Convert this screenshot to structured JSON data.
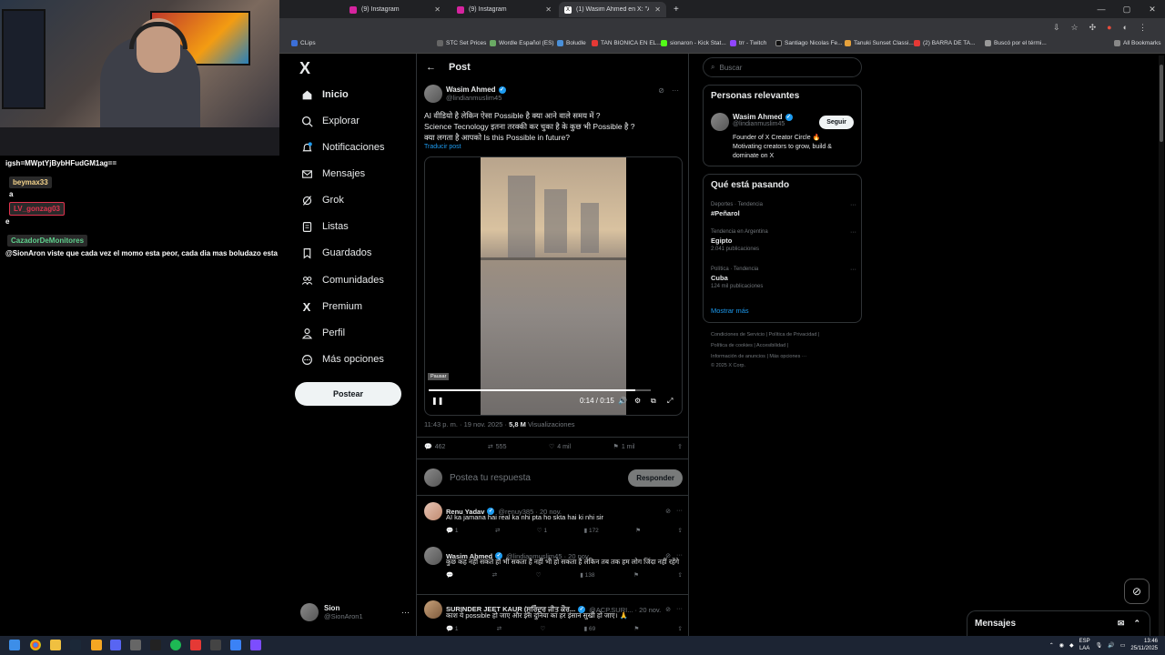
{
  "browser": {
    "tabs": [
      {
        "label": "(9) Instagram",
        "color": "#d6249f"
      },
      {
        "label": "(9) Instagram",
        "color": "#d6249f"
      },
      {
        "label": "(1) Wasim Ahmed en X: \"AI",
        "color": "#000000"
      }
    ],
    "bookmarks": [
      "CLips",
      "STC Set Prices",
      "Wordle Español (ES)",
      "Boludle",
      "TAN BIONICA EN EL...",
      "sionaron - Kick Stat...",
      "trr - Twitch",
      "Santiago Nicolas Fe...",
      "Tanuki Sunset Classi...",
      "(2) BARRA DE TA...",
      "Buscó por el térmi...",
      "All Bookmarks"
    ]
  },
  "chat": {
    "line1": "igsh=MWptYjBybHFudGM1ag==",
    "user1": "beymax33",
    "user1_msg": "a",
    "user2": "LV_gonzag03",
    "user2_msg": "e",
    "user3": "CazadorDeMonitores",
    "user3_msg": "@SionAron viste que cada vez el momo esta peor, cada dia mas boludazo esta"
  },
  "nav": {
    "logo": "X",
    "items": [
      "Inicio",
      "Explorar",
      "Notificaciones",
      "Mensajes",
      "Grok",
      "Listas",
      "Guardados",
      "Comunidades",
      "Premium",
      "Perfil",
      "Más opciones"
    ],
    "post_label": "Postear",
    "profile_name": "Sion",
    "profile_handle": "@SionAron1"
  },
  "main": {
    "header_title": "Post",
    "author_name": "Wasim Ahmed",
    "author_handle": "@lindianmuslim45",
    "text_line1": "AI वीडियो है लेकिन ऐसा Possible है क्या आने वाले समय में ?",
    "text_line2": "Science Tecnology इतना तरक्की कर चुका है के कुछ भी Possible है ?",
    "text_line3": "क्या लगता है आपको Is this Possible in future?",
    "translate": "Traducir post",
    "video_tip": "Pausar",
    "video_time": "0:14 / 0:15",
    "video_progress": 0.93,
    "meta_time": "11:43 p. m. · 19 nov. 2025 · ",
    "meta_views": "5,8 M",
    "meta_views_label": " Visualizaciones",
    "replies": "462",
    "reposts": "555",
    "likes": "4 mil",
    "bookmarks": "1 mil",
    "reply_placeholder": "Postea tu respuesta",
    "reply_button": "Responder"
  },
  "replies": [
    {
      "name": "Renu Yadav",
      "handle": "@renuy385 · 20 nov.",
      "text": "AI ka jamana hai real ka nhi pta ho skta hai ki nhi sir",
      "c": "1",
      "r": "",
      "l": "1",
      "v": "172"
    },
    {
      "name": "Wasim Ahmed",
      "handle": "@lindianmuslim45 · 20 nov.",
      "text": "कुछ कह नहीं सकते हो भी सकता है नहीं भी हो सकता है लेकिन तब तक हम लोग जिंदा नहीं रहेंगे",
      "c": "",
      "r": "",
      "l": "",
      "v": "138"
    },
    {
      "name": "SURINDER JEET KAUR (ਸੁਰਿੰਦਰ ਜੀਤ ਕੌਰ...",
      "handle": "@ACP.SURI... · 20 nov.",
      "text": "काश ये possible हो जाए और इस दुनिया का हर इंसान सुखी हो जाए। 🙏",
      "c": "1",
      "r": "",
      "l": "",
      "v": "69"
    }
  ],
  "right": {
    "search_placeholder": "Buscar",
    "relevant_title": "Personas relevantes",
    "rel_name": "Wasim Ahmed",
    "rel_handle": "@lindianmuslim45",
    "rel_follow": "Seguir",
    "rel_bio": "Founder of X Creator Circle 🔥 Motivating creators to grow, build & dominate on X",
    "trends_title": "Qué está pasando",
    "trends": [
      {
        "cat": "Deportes · Tendencia",
        "title": "#Peñarol",
        "count": ""
      },
      {
        "cat": "Tendencia en Argentina",
        "title": "Egipto",
        "count": "2.041 publicaciones"
      },
      {
        "cat": "Política · Tendencia",
        "title": "Cuba",
        "count": "124 mil publicaciones"
      }
    ],
    "show_more": "Mostrar más",
    "footer1": "Condiciones de Servicio  |  Política de Privacidad  |",
    "footer2": "Política de cookies  |  Accesibilidad  |",
    "footer3": "Información de anuncios  |  Más opciones ···",
    "footer4": "© 2025 X Corp."
  },
  "messages_label": "Mensajes",
  "taskbar": {
    "lang": "ESP",
    "lang2": "LAA",
    "time": "13:46",
    "date": "25/11/2025"
  }
}
